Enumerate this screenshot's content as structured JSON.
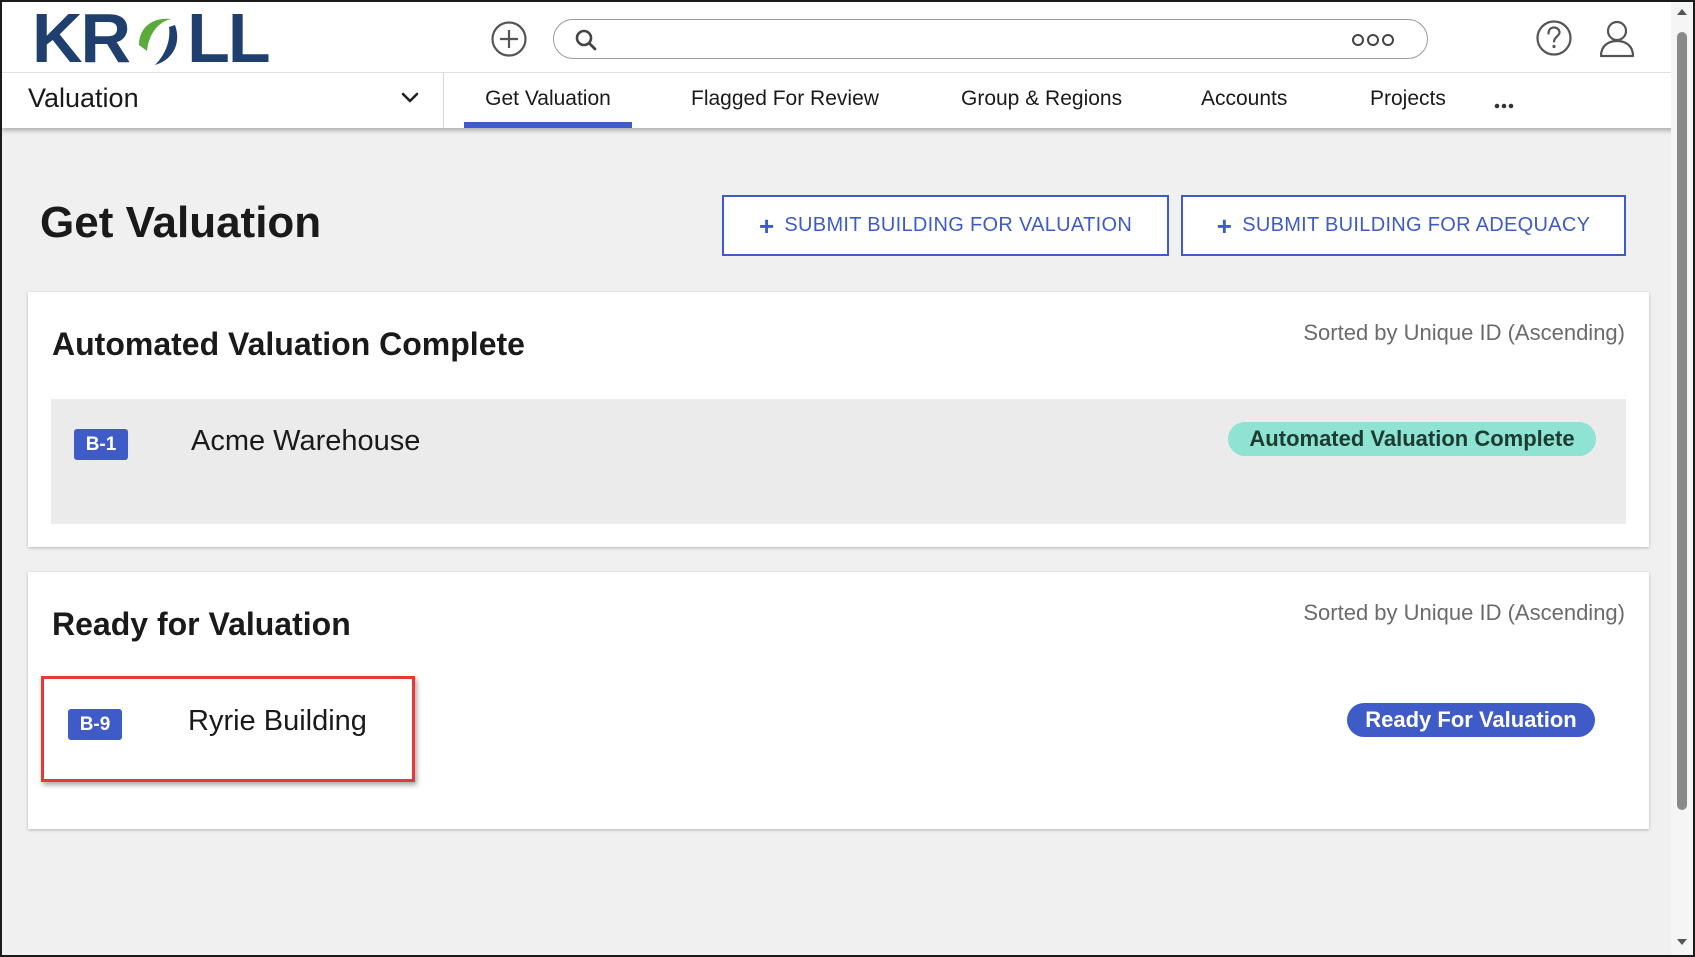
{
  "header": {
    "logo_left": "KR",
    "logo_right": "LL",
    "search": {
      "value": "",
      "placeholder": ""
    }
  },
  "nav": {
    "module": "Valuation",
    "tabs": [
      {
        "label": "Get Valuation",
        "active": true
      },
      {
        "label": "Flagged For Review",
        "active": false
      },
      {
        "label": "Group & Regions",
        "active": false
      },
      {
        "label": "Accounts",
        "active": false
      },
      {
        "label": "Projects",
        "active": false
      }
    ]
  },
  "page": {
    "title": "Get Valuation",
    "actions": {
      "submit_valuation": "SUBMIT BUILDING FOR VALUATION",
      "submit_adequacy": "SUBMIT BUILDING FOR ADEQUACY",
      "plus": "+"
    }
  },
  "sections": [
    {
      "title": "Automated Valuation Complete",
      "sort": "Sorted by Unique ID (Ascending)",
      "rows": [
        {
          "id": "B-1",
          "name": "Acme Warehouse",
          "status": "Automated Valuation Complete"
        }
      ]
    },
    {
      "title": "Ready for Valuation",
      "sort": "Sorted by Unique ID (Ascending)",
      "rows": [
        {
          "id": "B-9",
          "name": "Ryrie Building",
          "status": "Ready For Valuation"
        }
      ]
    }
  ],
  "colors": {
    "brand_navy": "#1f3f6e",
    "brand_green": "#5aaa3c",
    "accent_blue": "#3f5bc7",
    "status_complete_bg": "#8fe3d2",
    "highlight_red": "#e53935"
  }
}
